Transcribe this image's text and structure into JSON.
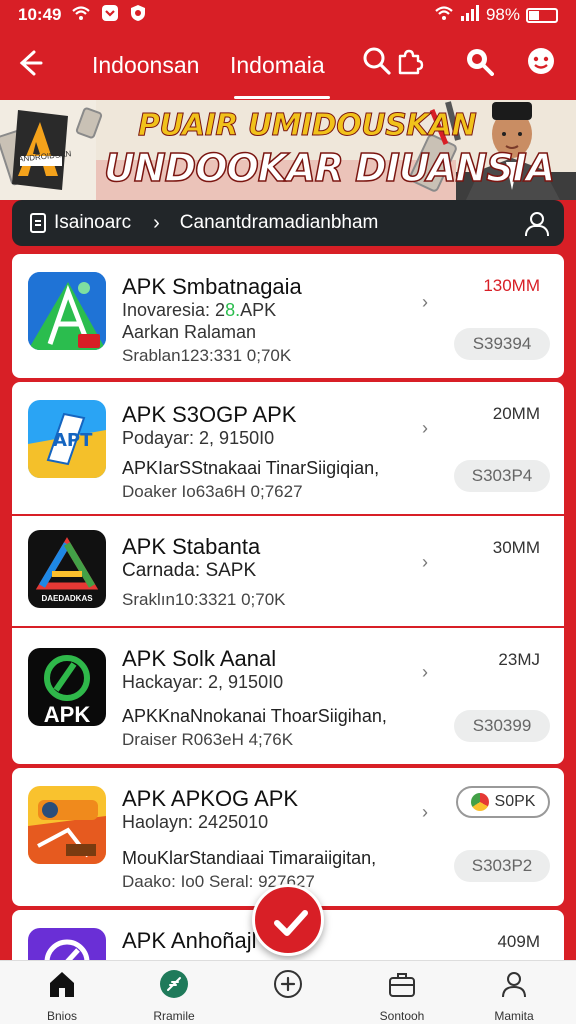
{
  "status_bar": {
    "time": "10:49",
    "battery": "98%"
  },
  "top_nav": {
    "tabs": [
      {
        "label": "Indoonsan"
      },
      {
        "label": "Indomaia"
      }
    ]
  },
  "banner": {
    "headline_1": "PUAIR UMIDOUSKAN",
    "headline_2": "UNDOOKAR DIUANSIA",
    "logo_caption": "ANDROIDSAN"
  },
  "breadcrumb": {
    "item_1": "Isainoarc",
    "item_2": "Canantdramadianbham"
  },
  "apps": [
    {
      "title": "APK Smbatnagaia",
      "line_2": "Inovaresia: 2",
      "line_2_accent": "8.",
      "line_2_tail": "APK",
      "line_3": "Aarkan Ralaman",
      "line_4": "Srablan123:331 0;70K",
      "size": "130MM",
      "size_red": true,
      "button": "S39394",
      "icon": "app-icon-blue-a"
    },
    {
      "title": "APK S3OGP APK",
      "line_2": "Podayar: 2, 9150I0",
      "line_3": "APKIarSStnakaai TinarSiigiqian,",
      "line_4": "Doaker Io63a6H 0;7627",
      "size": "20MM",
      "size_red": false,
      "button": "S303P4",
      "icon": "app-icon-apt"
    },
    {
      "title": "APK Stabanta",
      "line_2": "Carnada: SAPK",
      "line_3": "",
      "line_4": "Sraklın10:3321 0;70K",
      "size": "30MM",
      "size_red": false,
      "button": "",
      "icon": "app-icon-android-a",
      "icon_caption": "DAEDADKAS"
    },
    {
      "title": "APK Solk Aanal",
      "line_2": "Hackayar: 2, 9150I0",
      "line_3": "APKKnaNnokanai ThoarSiigihan,",
      "line_4": "Draiser R063eH 4;76K",
      "size": "23MJ",
      "size_red": false,
      "button": "S30399",
      "icon": "app-icon-apk-green",
      "icon_caption": "APK"
    },
    {
      "title": "APK APKOG APK",
      "line_2": "Haolayn: 2425010",
      "line_3": "MouKlarStandiaai Timaraiigitan,",
      "line_4": "Daako: Io0 Seral: 927627",
      "size": "",
      "size_red": false,
      "button": "S303P2",
      "tag": "S0PK",
      "icon": "app-icon-orange"
    },
    {
      "title": "APK Anhoñajl",
      "line_2": "",
      "line_3": "",
      "line_4": "",
      "size": "409M",
      "size_red": false,
      "button": "",
      "icon": "app-icon-purple"
    }
  ],
  "bottom_nav": [
    {
      "label": "Bnios",
      "icon": "home-icon",
      "active": true
    },
    {
      "label": "Rramile",
      "icon": "feather-icon",
      "active": false
    },
    {
      "label": "",
      "icon": "add-icon",
      "active": false
    },
    {
      "label": "Sontooh",
      "icon": "toolbox-icon",
      "active": false
    },
    {
      "label": "Mamita",
      "icon": "person-icon",
      "active": false
    }
  ],
  "colors": {
    "brand_red": "#d81f26",
    "crumb_dark": "#222629",
    "card_bg": "#ffffff",
    "button_bg": "#eceded"
  }
}
